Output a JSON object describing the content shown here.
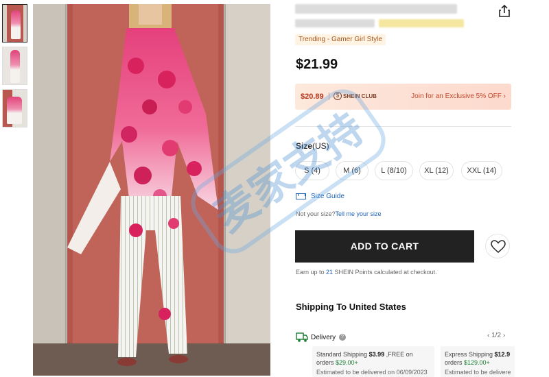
{
  "colors": {
    "accent_blue": "#1d63b7",
    "club_text": "#c2472a",
    "trending_text": "#a4571d",
    "cart_bg": "#222222",
    "free_green": "#197b30"
  },
  "thumbnails": [
    {
      "label": "thumbnail-1",
      "active": true
    },
    {
      "label": "thumbnail-2",
      "active": false
    },
    {
      "label": "thumbnail-3",
      "active": false
    }
  ],
  "product": {
    "trending_label": "Trending - Gamer Girl Style",
    "price": "$21.99",
    "share_icon": "share-icon"
  },
  "club": {
    "price": "$20.89",
    "label": "SHEIN CLUB",
    "join_text": "Join for an Exclusive 5% OFF ›"
  },
  "size": {
    "title_bold": "Size",
    "title_unit": "(US)",
    "options": [
      "S (4)",
      "M (6)",
      "L (8/10)",
      "XL (12)",
      "XXL (14)"
    ],
    "guide_label": "Size Guide",
    "not_your_size": "Not your size?",
    "tell_me": "Tell me your size"
  },
  "actions": {
    "add_to_cart": "ADD TO CART",
    "wishlist_icon": "heart-icon"
  },
  "points": {
    "prefix": "Earn up to ",
    "amount": "21",
    "suffix": " SHEIN Points calculated at checkout."
  },
  "shipping": {
    "title": "Shipping To United States",
    "delivery_label": "Delivery",
    "help_icon": "?",
    "pager": "1/2",
    "pager_prev": "‹",
    "pager_next": "›",
    "options": [
      {
        "name": "Standard Shipping ",
        "price": "$3.99",
        "free_text": " ,FREE on",
        "line2_prefix": "orders ",
        "threshold": "$29.00+",
        "estimate": "Estimated to be delivered on 06/09/2023"
      },
      {
        "name": "Express Shipping ",
        "price": "$12.9",
        "free_text": "",
        "line2_prefix": "orders ",
        "threshold": "$129.00+",
        "estimate": "Estimated to be delivere"
      }
    ]
  },
  "watermark": {
    "text": "麦家支持"
  }
}
